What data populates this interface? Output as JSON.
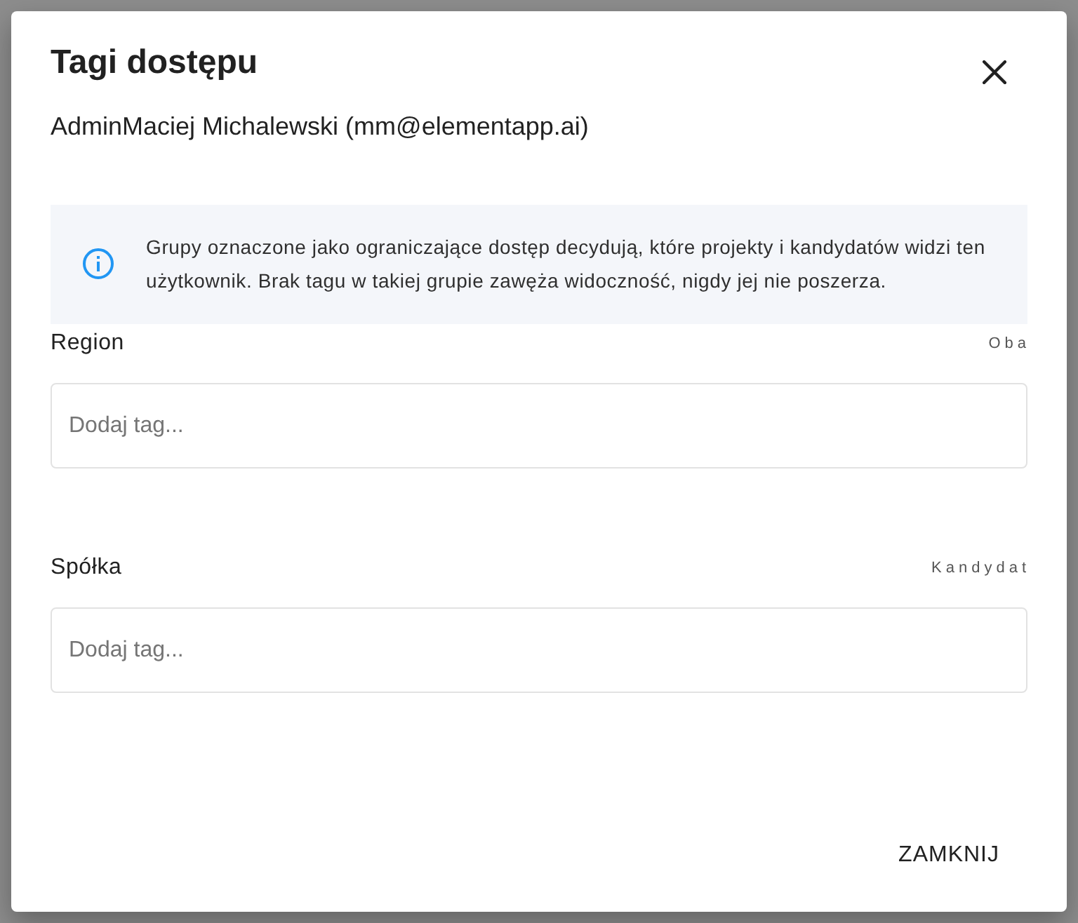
{
  "dialog": {
    "title": "Tagi dostępu",
    "subtitle": "AdminMaciej Michalewski (mm@elementapp.ai)",
    "info": "Grupy oznaczone jako ograniczające dostęp decydują, które projekty i kandydatów widzi ten użytkownik. Brak tagu w takiej grupie zawęża widoczność, nigdy jej nie poszerza.",
    "groups": [
      {
        "label": "Region",
        "scope": "Oba",
        "field": {
          "placeholder": "Dodaj tag..."
        }
      },
      {
        "label": "Spółka",
        "scope": "Kandydat",
        "field": {
          "placeholder": "Dodaj tag..."
        }
      }
    ],
    "buttons": [
      "ZAMKNIJ"
    ]
  }
}
